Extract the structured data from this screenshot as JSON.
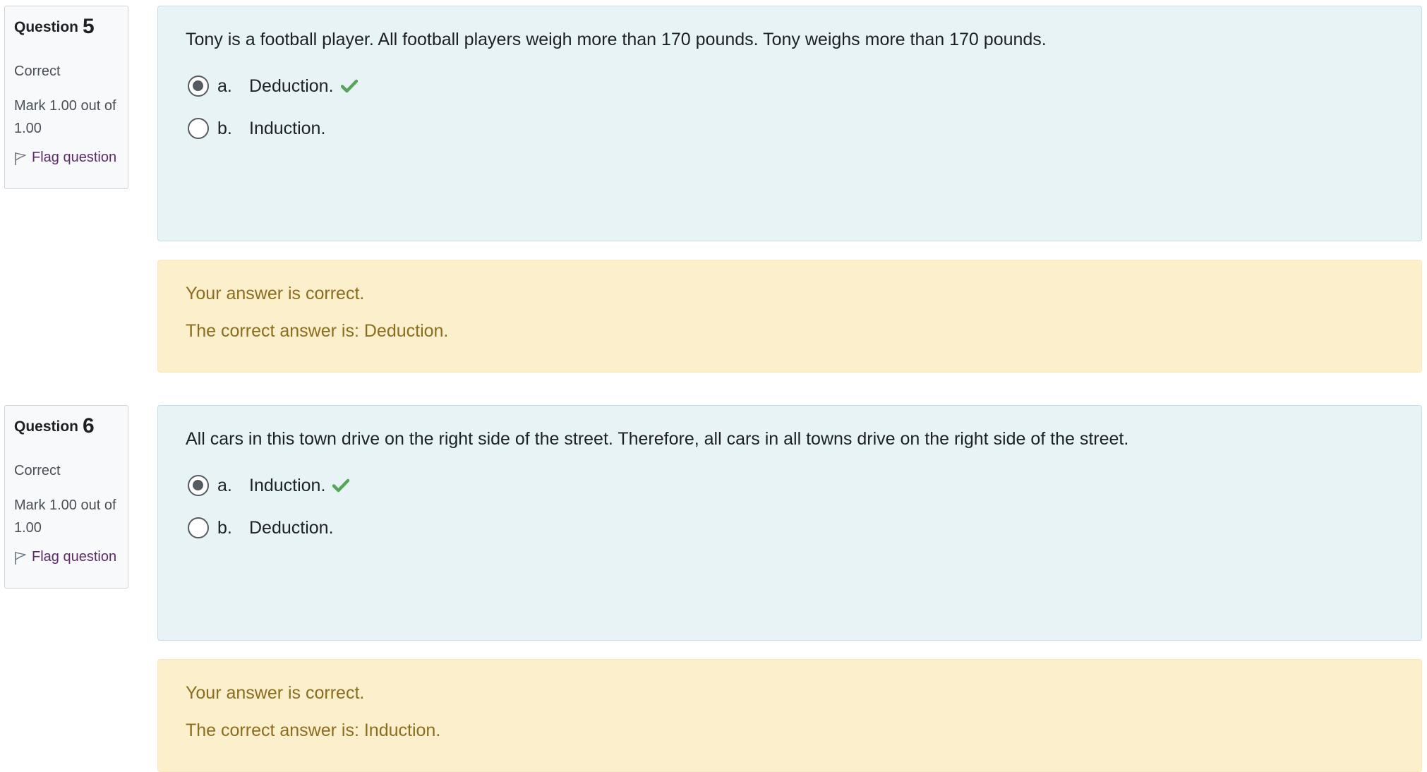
{
  "questions": [
    {
      "label": "Question",
      "number": "5",
      "state": "Correct",
      "grade": "Mark 1.00 out of 1.00",
      "flag_label": "Flag question",
      "text": "Tony is a football player. All football players weigh more than 170 pounds. Tony weighs more than 170 pounds.",
      "answers": [
        {
          "letter": "a.",
          "text": "Deduction.",
          "selected": true,
          "correct_mark": true
        },
        {
          "letter": "b.",
          "text": "Induction.",
          "selected": false,
          "correct_mark": false
        }
      ],
      "feedback": {
        "status": "Your answer is correct.",
        "right_answer": "The correct answer is: Deduction."
      }
    },
    {
      "label": "Question",
      "number": "6",
      "state": "Correct",
      "grade": "Mark 1.00 out of 1.00",
      "flag_label": "Flag question",
      "text": "All cars in this town drive on the right side of the street. Therefore, all cars in all towns drive on the right side of the street.",
      "answers": [
        {
          "letter": "a.",
          "text": "Induction.",
          "selected": true,
          "correct_mark": true
        },
        {
          "letter": "b.",
          "text": "Deduction.",
          "selected": false,
          "correct_mark": false
        }
      ],
      "feedback": {
        "status": "Your answer is correct.",
        "right_answer": "The correct answer is: Induction."
      }
    }
  ],
  "colors": {
    "info_bg": "#f8f9fa",
    "formulation_bg": "#e7f3f5",
    "feedback_bg": "#fcefcc",
    "feedback_text": "#8a6d1e",
    "flag_link": "#5c2b67",
    "correct_check": "#57a55a"
  },
  "icons": {
    "flag": "flag-icon",
    "correct": "check-icon"
  }
}
